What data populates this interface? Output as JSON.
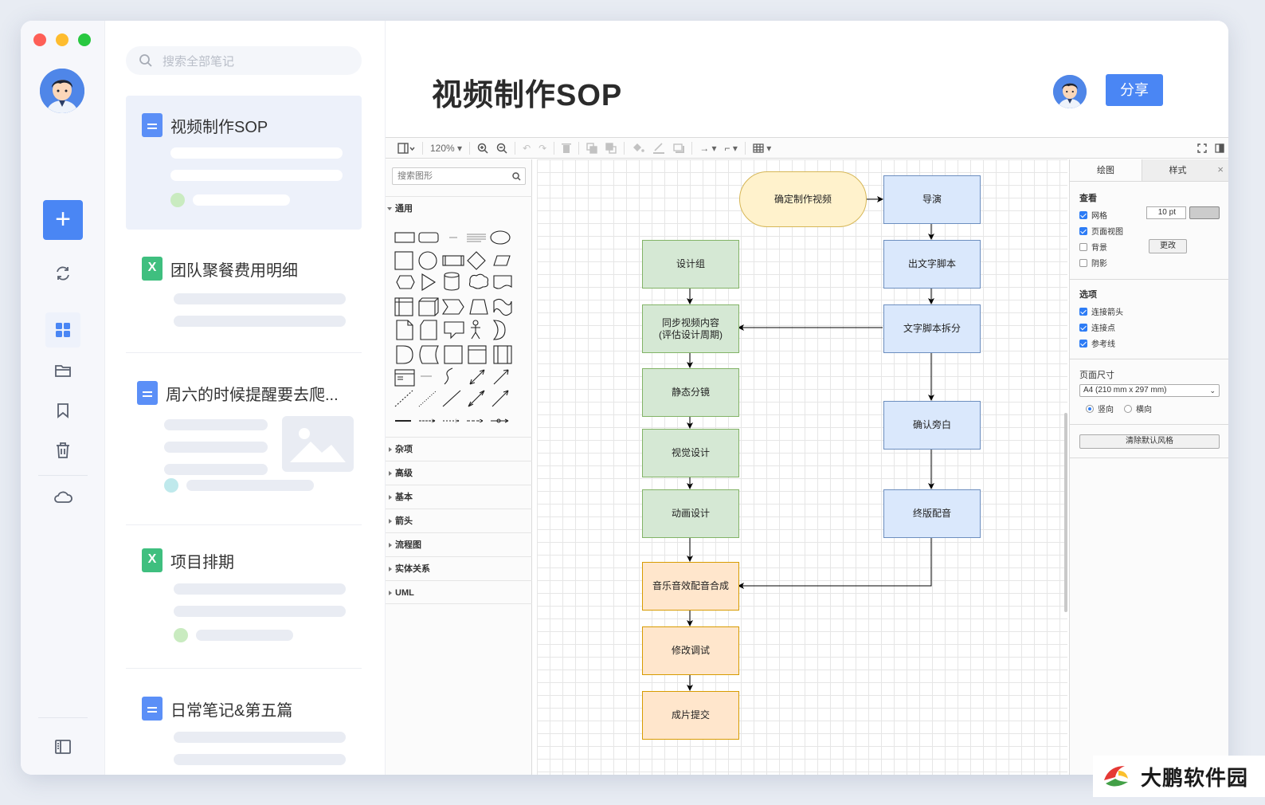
{
  "window": {
    "traffic_colors": [
      "#fe5f57",
      "#febc2e",
      "#28c840"
    ]
  },
  "rail": {
    "add_label": "+",
    "icons": [
      "refresh-icon",
      "grid-icon",
      "folder-icon",
      "bookmark-icon",
      "trash-icon",
      "cloud-icon",
      "sidebar-toggle-icon"
    ]
  },
  "notes": {
    "search_placeholder": "搜索全部笔记",
    "items": [
      {
        "title": "视频制作SOP",
        "type": "doc"
      },
      {
        "title": "团队聚餐费用明细",
        "type": "sheet"
      },
      {
        "title": "周六的时候提醒要去爬...",
        "type": "doc"
      },
      {
        "title": "项目排期",
        "type": "sheet"
      },
      {
        "title": "日常笔记&第五篇",
        "type": "doc"
      }
    ]
  },
  "header": {
    "title": "视频制作SOP",
    "share_label": "分享"
  },
  "toolbar": {
    "zoom": "120%"
  },
  "shapes_panel": {
    "search_placeholder": "搜索图形",
    "sections": [
      "通用",
      "杂项",
      "高级",
      "基本",
      "箭头",
      "流程图",
      "实体关系",
      "UML"
    ]
  },
  "diagram": {
    "nodes": {
      "start": "确定制作视频",
      "director": "导演",
      "script": "出文字脚本",
      "split": "文字脚本拆分",
      "voice_confirm": "确认旁白",
      "final_voice": "终版配音",
      "design_group": "设计组",
      "sync_1": "同步视频内容",
      "sync_2": "(评估设计周期)",
      "storyboard": "静态分镜",
      "visual": "视觉设计",
      "animation": "动画设计",
      "music": "音乐音效配音合成",
      "revise": "修改调试",
      "submit": "成片提交"
    },
    "colors": {
      "green_fill": "#d5e8d4",
      "blue_fill": "#dae8fc",
      "orange_fill": "#ffe6cc",
      "yellow_fill": "#fff2cc"
    }
  },
  "format_panel": {
    "tabs": [
      "绘图",
      "样式"
    ],
    "view_label": "查看",
    "grid_label": "网格",
    "grid_size": "10 pt",
    "page_view_label": "页面视图",
    "background_label": "背景",
    "change_label": "更改",
    "shadow_label": "阴影",
    "options_label": "选项",
    "connect_arrows_label": "连接箭头",
    "connect_points_label": "连接点",
    "guides_label": "参考线",
    "page_size_label": "页面尺寸",
    "page_size_value": "A4 (210 mm x 297 mm)",
    "portrait_label": "竖向",
    "landscape_label": "横向",
    "clear_style_label": "清除默认风格"
  },
  "watermark": {
    "text": "大鹏软件园"
  }
}
